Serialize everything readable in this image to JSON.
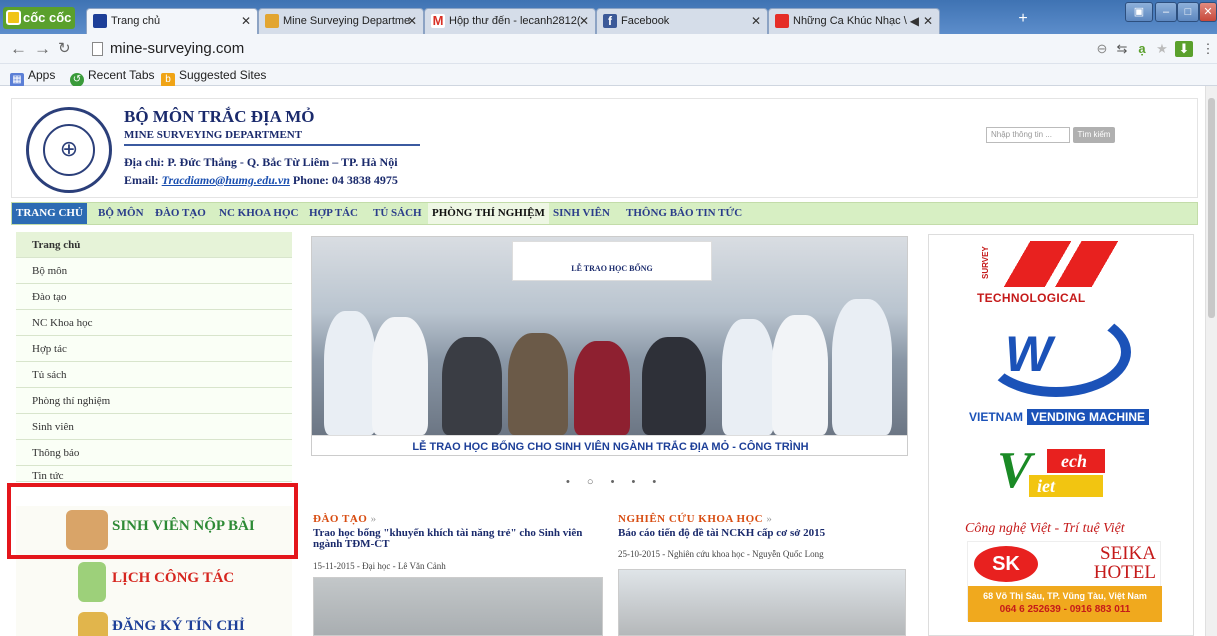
{
  "browser": {
    "brand": "cốc cốc",
    "tabs": [
      {
        "label": "Trang chủ",
        "active": true
      },
      {
        "label": "Mine Surveying Departme",
        "active": false
      },
      {
        "label": "Hộp thư đến - lecanh2812(",
        "active": false
      },
      {
        "label": "Facebook",
        "active": false
      },
      {
        "label": "Những Ca Khúc Nhạc \\ ",
        "active": false
      }
    ],
    "url": "mine-surveying.com",
    "bookmarks": [
      "Apps",
      "Recent Tabs",
      "Suggested Sites"
    ],
    "accent": "#3f73b3"
  },
  "site": {
    "dept_title": "BỘ MÔN TRẮC ĐỊA MỎ",
    "dept_subtitle": "MINE SURVEYING DEPARTMENT",
    "address": "Địa chỉ: P. Đức Thắng - Q. Bắc Từ Liêm – TP. Hà Nội",
    "email_label": "Email:",
    "email": "Tracdiamo@humg.edu.vn",
    "phone": "Phone: 04 3838 4975",
    "search_placeholder": "Nhập thông tin ...",
    "search_button": "Tìm kiếm"
  },
  "menu": [
    "TRANG CHỦ",
    "BỘ MÔN",
    "ĐÀO TẠO",
    "NC KHOA HỌC",
    "HỢP TÁC",
    "TỦ SÁCH",
    "PHÒNG THÍ NGHIỆM",
    "SINH VIÊN",
    "THÔNG BÁO",
    "TIN TỨC"
  ],
  "sidebar": [
    "Trang chủ",
    "Bộ môn",
    "Đào tạo",
    "NC Khoa học",
    "Hợp tác",
    "Tủ sách",
    "Phòng thí nghiệm",
    "Sinh viên",
    "Thông báo",
    "Tin tức"
  ],
  "banners": {
    "submit": "SINH VIÊN NỘP BÀI",
    "schedule": "LỊCH CÔNG TÁC",
    "register": "ĐĂNG KÝ TÍN CHỈ"
  },
  "slider": {
    "banner_title": "LỄ TRAO HỌC BỔNG",
    "caption": "LỄ TRAO HỌC BỔNG CHO SINH VIÊN NGÀNH TRẮC ĐỊA MỎ - CÔNG TRÌNH",
    "dots": "• ○ • • •"
  },
  "news": [
    {
      "category": "ĐÀO TẠO",
      "title": "Trao học bổng \"khuyến khích tài năng trẻ\" cho Sinh viên ngành TĐM-CT",
      "meta": "15-11-2015 - Đại học - Lê Văn Cảnh"
    },
    {
      "category": "NGHIÊN CỨU KHOA HỌC",
      "title": "Báo cáo tiến độ đề tài NCKH cấp cơ sở 2015",
      "meta": "25-10-2015 - Nghiên cứu khoa học - Nguyễn Quốc Long"
    }
  ],
  "ads": {
    "survey": "SURVEY",
    "technological": "TECHNOLOGICAL",
    "vietnam": "VIETNAM",
    "vending": "VENDING MACHINE",
    "slogan": "Công nghệ Việt - Trí tuệ Việt",
    "hotel_top": "SEIKA",
    "hotel_bottom": "HOTEL",
    "hotel_address": "68 Võ Thị Sáu, TP. Vũng Tàu, Việt Nam",
    "hotel_phone": "064 6 252639 - 0916 883 011"
  }
}
